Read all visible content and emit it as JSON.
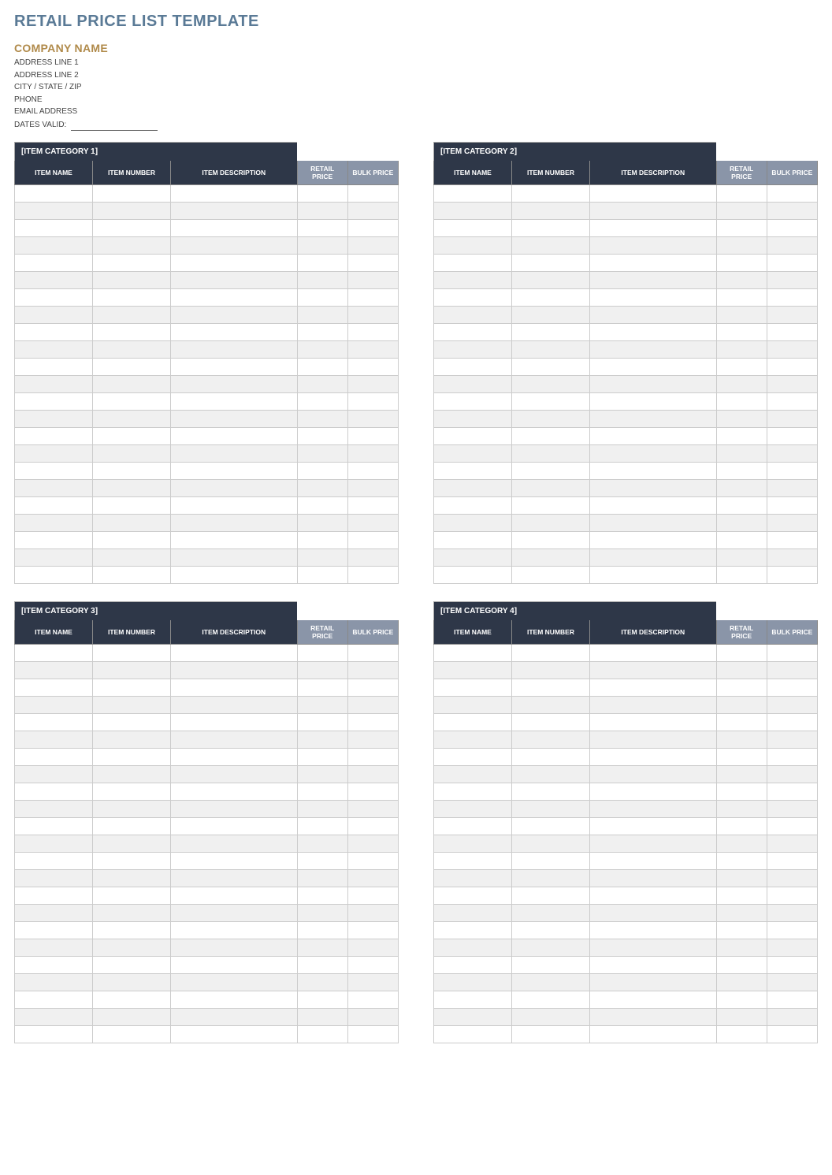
{
  "header": {
    "title": "RETAIL PRICE LIST TEMPLATE",
    "company_name": "COMPANY NAME",
    "address1": "ADDRESS LINE 1",
    "address2": "ADDRESS LINE 2",
    "city_state_zip": "CITY / STATE / ZIP",
    "phone": "PHONE",
    "email": "EMAIL ADDRESS",
    "dates_valid_label": "DATES VALID:"
  },
  "columns": {
    "item_name": "ITEM NAME",
    "item_number": "ITEM NUMBER",
    "item_description": "ITEM DESCRIPTION",
    "retail_price": "RETAIL PRICE",
    "bulk_price": "BULK PRICE"
  },
  "categories": [
    {
      "title": "[ITEM CATEGORY 1]",
      "rows": 23
    },
    {
      "title": "[ITEM CATEGORY 2]",
      "rows": 23
    },
    {
      "title": "[ITEM CATEGORY 3]",
      "rows": 23
    },
    {
      "title": "[ITEM CATEGORY 4]",
      "rows": 23
    }
  ]
}
